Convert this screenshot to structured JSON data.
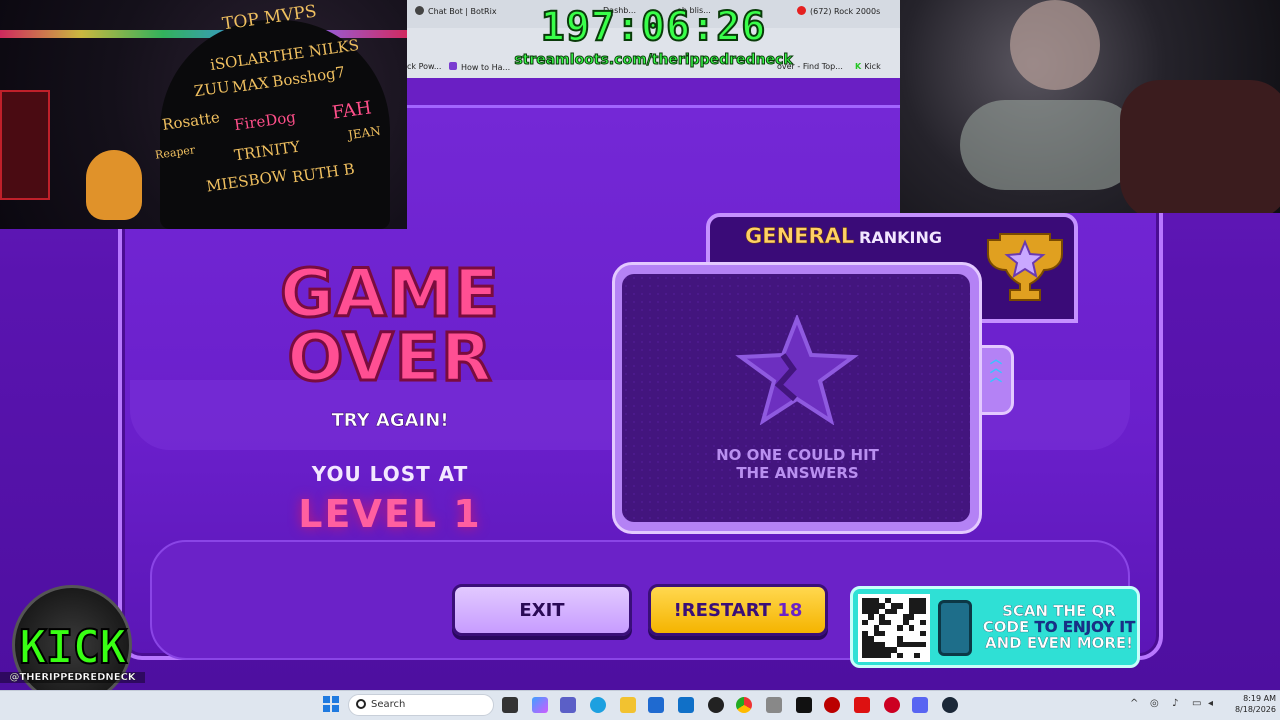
{
  "stream": {
    "timer": "197:06:26",
    "loots_url": "streamloots.com/therippedredneck",
    "kick_logo_text": "KICK",
    "kick_handle": "@THERIPPEDREDNECK",
    "webcam_left_signs": [
      "TOP MVPS",
      "iSOLAR",
      "THE NILKS",
      "ZUU",
      "MAX",
      "Bosshog7",
      "FAH",
      "Rosatte",
      "FireDog",
      "JEAN",
      "Reaper",
      "TRINITY",
      "RUTH B",
      "MIESBOW"
    ]
  },
  "browser": {
    "tabs": [
      "Chat Bot | BotRix",
      "Dashb...",
      "oh blis...",
      "(672) Rock 2000s"
    ],
    "bookmarks": [
      "ck Pow...",
      "How to Ha...",
      "over - Find Top...",
      "Kick"
    ]
  },
  "game": {
    "title_line1": "GAME",
    "title_line2": "OVER",
    "subtitle": "TRY AGAIN!",
    "lost_label": "YOU LOST AT",
    "level": "LEVEL 1",
    "ranking_word": "GENERAL",
    "ranking_label": "RANKING",
    "empty_message_line1": "NO ONE COULD HIT",
    "empty_message_line2": "THE ANSWERS",
    "exit_button": "EXIT",
    "restart_button": "!RESTART",
    "restart_count": "18",
    "qr_text_1": "SCAN THE QR",
    "qr_text_2a": "CODE",
    "qr_text_2b": "TO ENJOY IT",
    "qr_text_3": "AND EVEN MORE!"
  },
  "taskbar": {
    "search_placeholder": "Search",
    "time": "8:19 AM",
    "date": "8/18/2026"
  },
  "colors": {
    "accent_pink": "#ff4f93",
    "button_yellow": "#f5b400",
    "timer_green": "#39ff4a",
    "qr_teal": "#2fe0d5"
  },
  "icons": [
    "windows-start-icon",
    "search-icon",
    "task-view-icon",
    "copilot-icon",
    "teams-icon",
    "edge-icon",
    "file-explorer-icon",
    "store-icon",
    "outlook-icon",
    "obs-icon",
    "chrome-icon",
    "tool-icon",
    "terminal-icon",
    "app-red-icon",
    "gta-icon",
    "app-icon",
    "discord-icon",
    "steam-icon",
    "chevron-up-icon",
    "network-icon",
    "mic-icon",
    "volume-icon"
  ]
}
